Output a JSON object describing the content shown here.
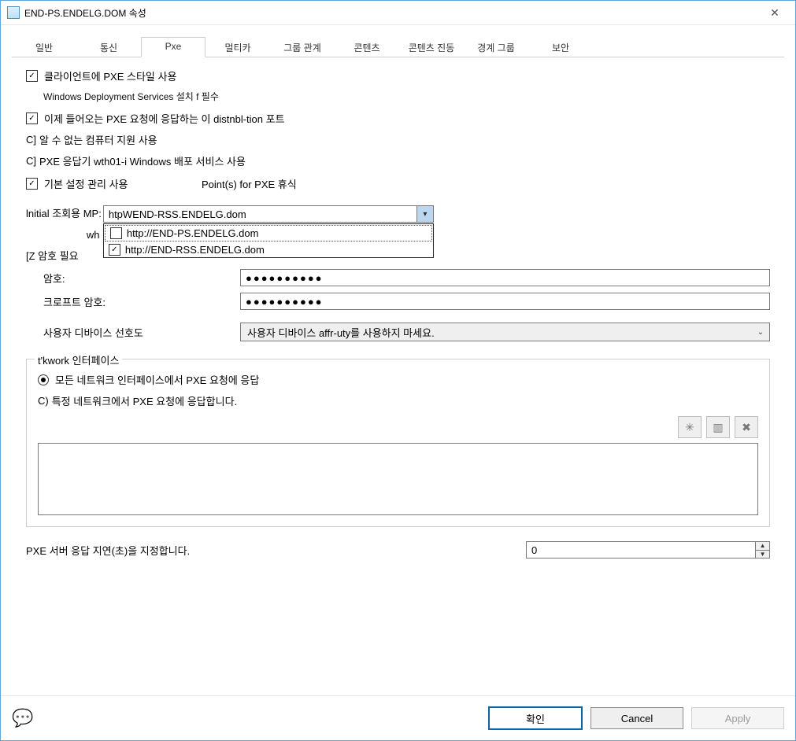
{
  "window": {
    "title": "END-PS.ENDELG.DOM 속성"
  },
  "tabs": [
    "일반",
    "통신",
    "Pxe",
    "멀티카",
    "그룹 관계",
    "콘텐츠",
    "콘텐츠 진동",
    "경계 그룹",
    "보안"
  ],
  "activeTab": "Pxe",
  "pxe": {
    "chk_enable_pxe": "클라이언트에 PXE 스타일 사용",
    "wds_note": "Windows Deployment Services 설치 f 필수",
    "chk_allow_incoming": "이제 들어오는 PXE 요청에 응답하는 이 distnbl-tion 포트",
    "chk_unknown_computers": "알 수 없는 컴퓨터 지원 사용",
    "chk_wds_responder": "PXE 응답기 wth01-i Windows 배포 서비스 사용",
    "chk_manage_settings": "기본 설정 관리 사용",
    "points_for_pxe": "Point(s) for PXE 휴식",
    "mp_label": "lnitial 조회용 MP:",
    "mp_value": "htpWEND-RSS.ENDELG.dom",
    "mp_options": [
      {
        "label": "http://END-PS.ENDELG.dom",
        "checked": false
      },
      {
        "label": "http://END-RSS.ENDELG.dom",
        "checked": true
      }
    ],
    "wh_text": "wh",
    "password_section_label": "[Z 암호 필요",
    "password_label": "암호:",
    "confirm_label": "크로프트 암호:",
    "password_mask": "●●●●●●●●●●",
    "confirm_mask": "●●●●●●●●●●",
    "affinity_label": "사용자 디바이스 선호도",
    "affinity_value": "사용자 디바이스 affr-uty를 사용하지 마세요.",
    "network_group_title": "t'kwork 인터페이스",
    "radio_all": "모든 네트워크 인터페이스에서 PXE 요청에 응답",
    "radio_specific": "특정 네트워크에서 PXE 요청에 응답합니다.",
    "delay_label": "PXE 서버 응답 지연(초)을 지정합니다.",
    "delay_value": "0"
  },
  "footer": {
    "ok": "확인",
    "cancel": "Cancel",
    "apply": "Apply"
  },
  "cbrackets": "C]"
}
